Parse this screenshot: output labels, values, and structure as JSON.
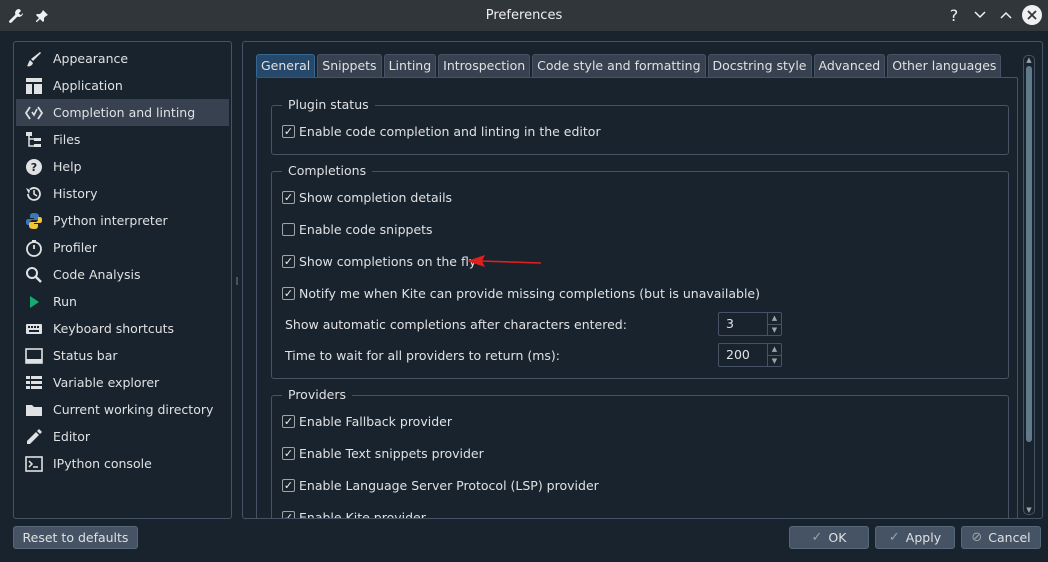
{
  "window": {
    "title": "Preferences",
    "help_glyph": "?"
  },
  "sidebar": {
    "items": [
      {
        "label": "Appearance",
        "icon": "brush-icon"
      },
      {
        "label": "Application",
        "icon": "layout-icon"
      },
      {
        "label": "Completion and linting",
        "icon": "code-icon"
      },
      {
        "label": "Files",
        "icon": "file-tree-icon"
      },
      {
        "label": "Help",
        "icon": "help-icon"
      },
      {
        "label": "History",
        "icon": "history-icon"
      },
      {
        "label": "Python interpreter",
        "icon": "python-icon"
      },
      {
        "label": "Profiler",
        "icon": "profiler-icon"
      },
      {
        "label": "Code Analysis",
        "icon": "search-icon"
      },
      {
        "label": "Run",
        "icon": "play-icon"
      },
      {
        "label": "Keyboard shortcuts",
        "icon": "keyboard-icon"
      },
      {
        "label": "Status bar",
        "icon": "statusbar-icon"
      },
      {
        "label": "Variable explorer",
        "icon": "table-icon"
      },
      {
        "label": "Current working directory",
        "icon": "folder-icon"
      },
      {
        "label": "Editor",
        "icon": "edit-icon"
      },
      {
        "label": "IPython console",
        "icon": "terminal-icon"
      }
    ],
    "selected": "Completion and linting"
  },
  "tabs": [
    {
      "label": "General",
      "active": true
    },
    {
      "label": "Snippets",
      "active": false
    },
    {
      "label": "Linting",
      "active": false
    },
    {
      "label": "Introspection",
      "active": false
    },
    {
      "label": "Code style and formatting",
      "active": false
    },
    {
      "label": "Docstring style",
      "active": false
    },
    {
      "label": "Advanced",
      "active": false
    },
    {
      "label": "Other languages",
      "active": false
    }
  ],
  "plugin_status": {
    "title": "Plugin status",
    "enable_label": "Enable code completion and linting in the editor",
    "enable_checked": true
  },
  "completions": {
    "title": "Completions",
    "options": [
      {
        "label": "Show completion details",
        "checked": true
      },
      {
        "label": "Enable code snippets",
        "checked": false
      },
      {
        "label": "Show completions on the fly",
        "checked": true
      },
      {
        "label": "Notify me when Kite can provide missing completions (but is unavailable)",
        "checked": true
      }
    ],
    "chars_label": "Show automatic completions after characters entered:",
    "chars_value": "3",
    "wait_label": "Time to wait for all providers to return (ms):",
    "wait_value": "200"
  },
  "providers": {
    "title": "Providers",
    "options": [
      {
        "label": "Enable Fallback provider",
        "checked": true
      },
      {
        "label": "Enable Text snippets provider",
        "checked": true
      },
      {
        "label": "Enable Language Server Protocol (LSP) provider",
        "checked": true
      },
      {
        "label": "Enable Kite provider",
        "checked": true
      }
    ]
  },
  "buttons": {
    "reset": "Reset to defaults",
    "ok": "OK",
    "apply": "Apply",
    "cancel": "Cancel"
  },
  "colors": {
    "background": "#19232d",
    "selected": "#37414f",
    "accent": "#26486b",
    "annotation_arrow": "#e0201b"
  }
}
